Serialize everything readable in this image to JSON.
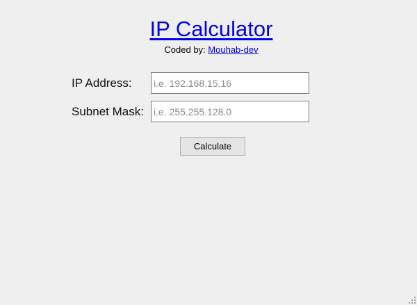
{
  "header": {
    "title": "IP Calculator",
    "credit_prefix": "Coded by:",
    "credit_link": "Mouhab-dev"
  },
  "form": {
    "ip_label": "IP Address:",
    "ip_placeholder": "i.e. 192.168.15.16",
    "ip_value": "",
    "mask_label": "Subnet Mask:",
    "mask_placeholder": "i.e. 255.255.128.0",
    "mask_value": "",
    "calculate_label": "Calculate"
  },
  "icons": {
    "resize_grip": "resize-grip-icon"
  },
  "colors": {
    "background": "#f0eff0",
    "link": "#0000ee",
    "button_bg": "#e4e4e4",
    "input_border": "#7a7a7a"
  }
}
